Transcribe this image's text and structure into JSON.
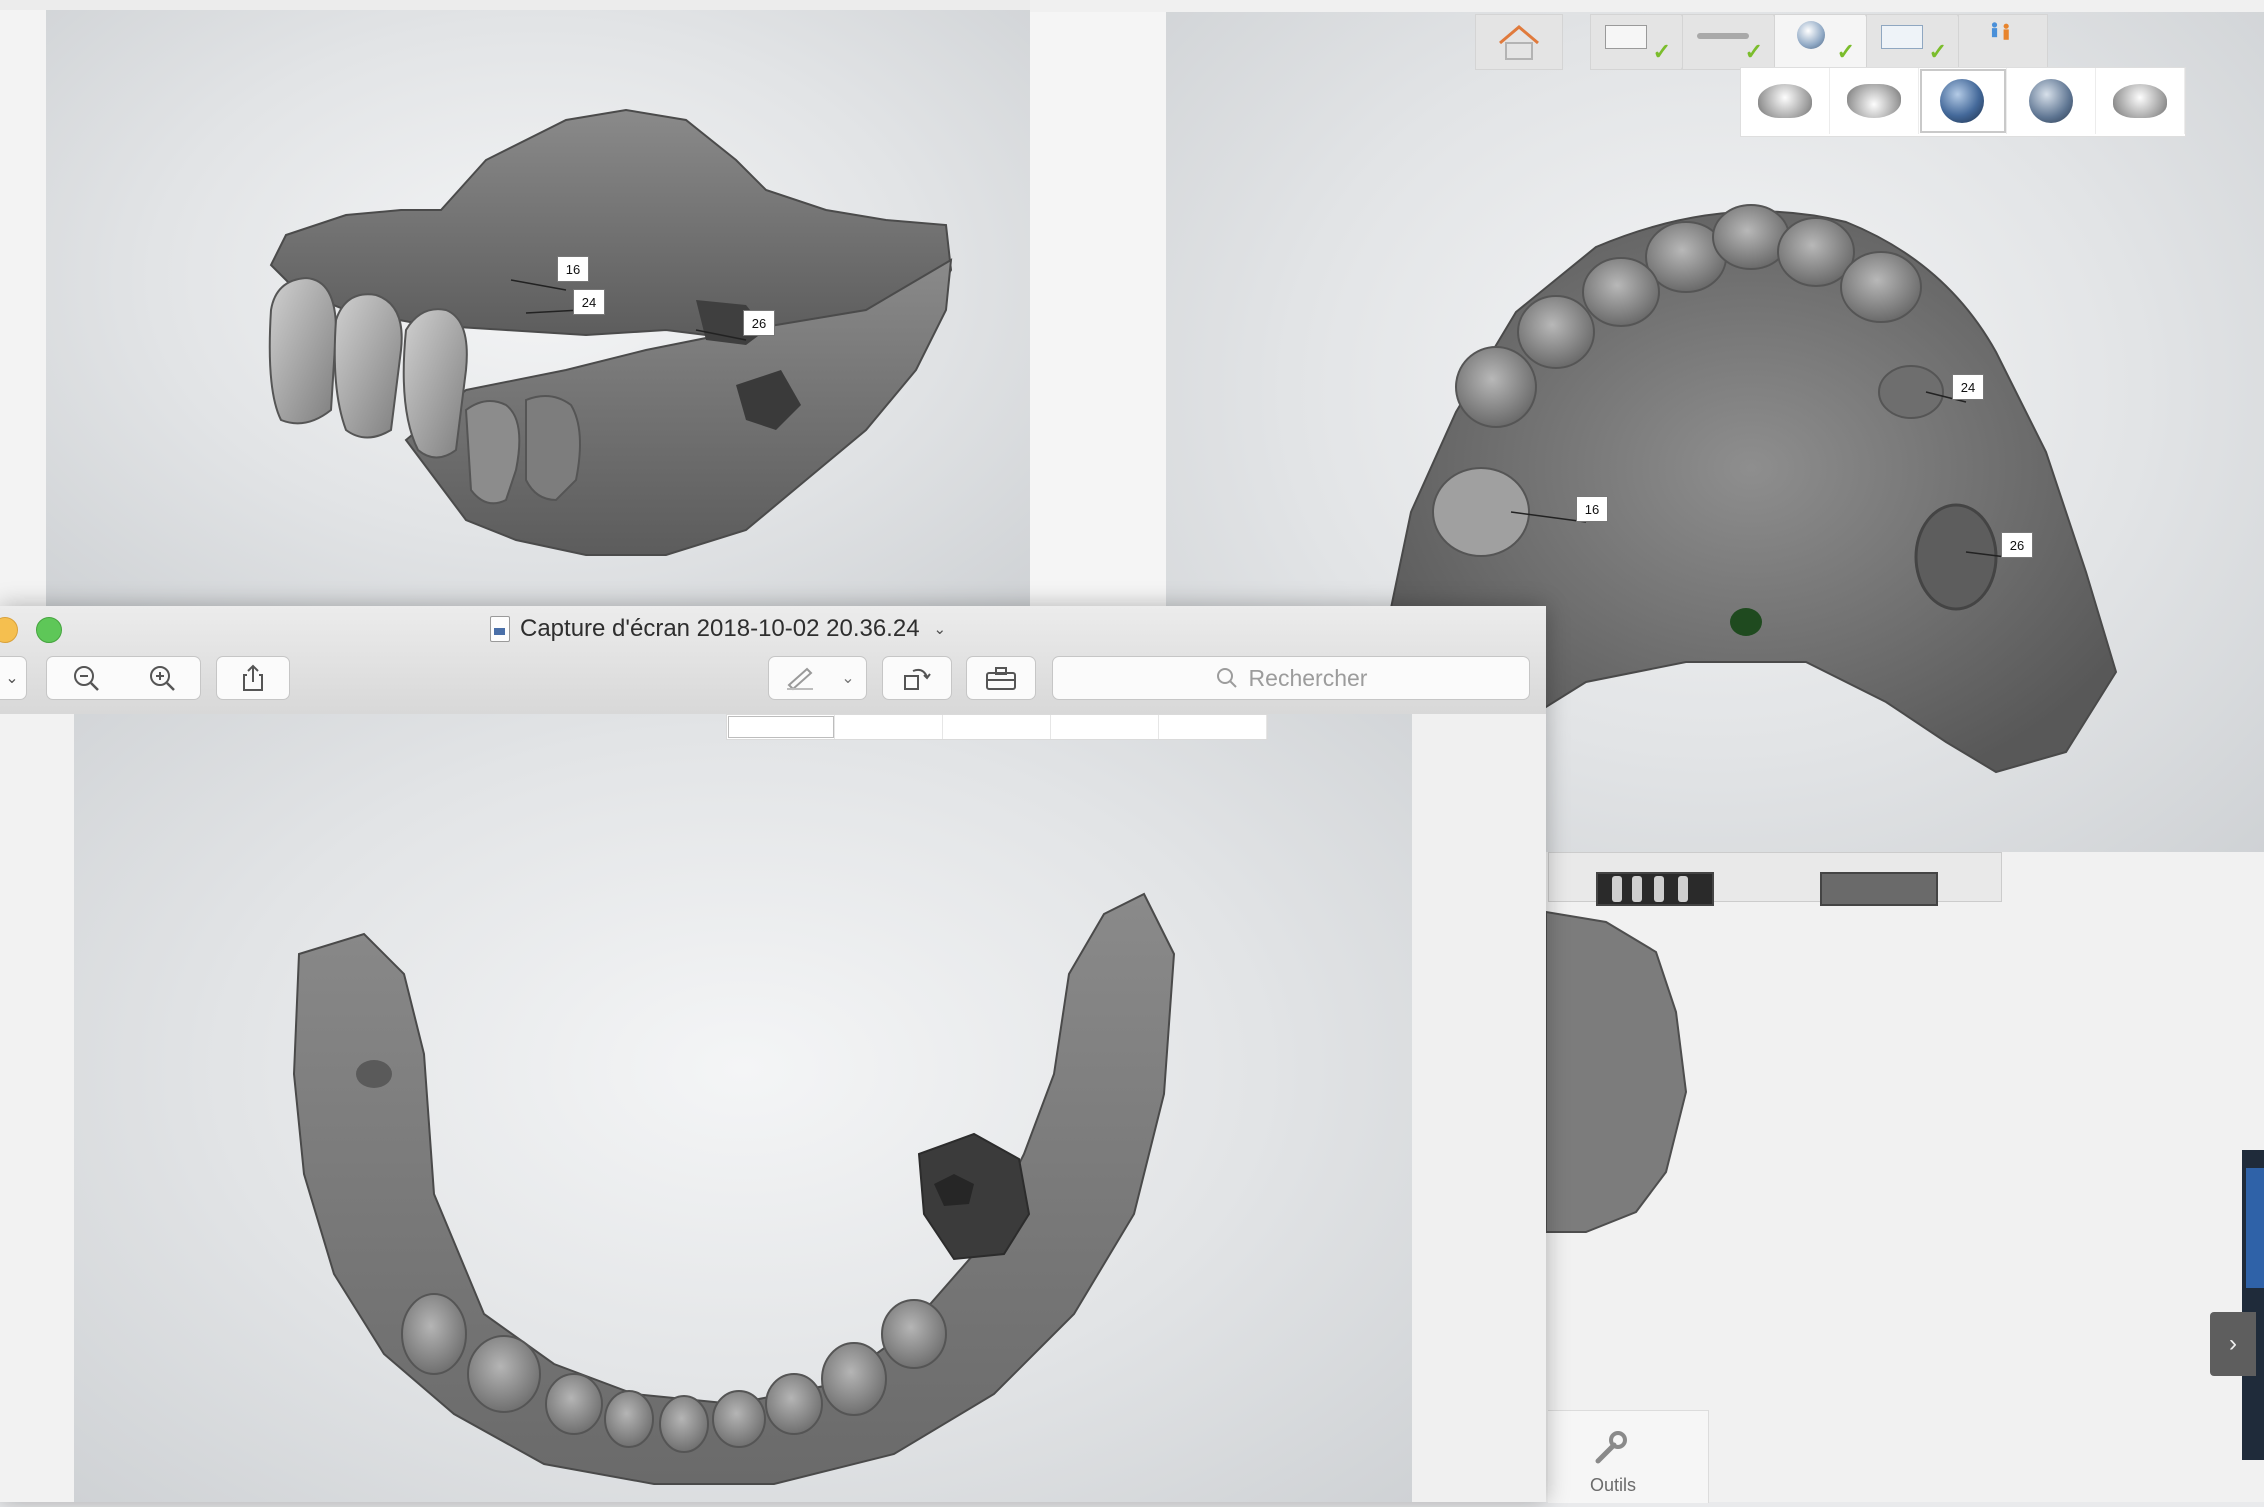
{
  "scan_top_left": {
    "tooth_labels": [
      "16",
      "24",
      "26"
    ]
  },
  "scan_top_right": {
    "tooth_labels": [
      "24",
      "16",
      "26"
    ],
    "workflow_steps": [
      {
        "icon": "order-form-icon",
        "done": true
      },
      {
        "icon": "scanner-wand-icon",
        "done": true
      },
      {
        "icon": "scan-globe-icon",
        "done": true
      },
      {
        "icon": "send-mail-icon",
        "done": true
      },
      {
        "icon": "lab-users-icon",
        "done": false
      }
    ],
    "thumbnails": [
      "upper-jaw-thumb",
      "lower-jaw-thumb",
      "bite-globe-thumb",
      "globe-thumb",
      "both-jaws-thumb"
    ],
    "selected_thumbnail": 2
  },
  "tools_panel": {
    "label": "Outils",
    "icon": "wrench-icon"
  },
  "preview_window": {
    "title": "Capture d'écran 2018-10-02 20.36.24",
    "search_placeholder": "Rechercher",
    "toolbar_icons": [
      "sidebar-chevron-icon",
      "zoom-out-icon",
      "zoom-in-icon",
      "share-icon",
      "markup-pen-icon",
      "markup-menu-chevron-icon",
      "rotate-icon",
      "toolbox-icon"
    ]
  },
  "colors": {
    "accent_check": "#7bbd2c",
    "home_icon": "#e07a3c",
    "label_bg": "#ffffff"
  }
}
